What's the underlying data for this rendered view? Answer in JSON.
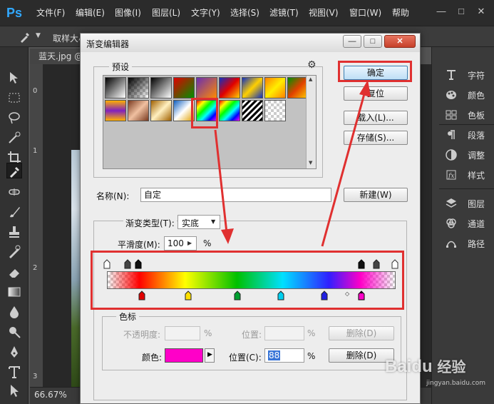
{
  "app": {
    "logo": "Ps"
  },
  "menu": [
    "文件(F)",
    "编辑(E)",
    "图像(I)",
    "图层(L)",
    "文字(Y)",
    "选择(S)",
    "滤镜(T)",
    "视图(V)",
    "窗口(W)",
    "帮助"
  ],
  "window_controls": {
    "minimize": "—",
    "restore": "□",
    "close": "✕"
  },
  "options_bar": {
    "sample_label": "取样大小"
  },
  "document": {
    "tab": "蓝天.jpg @",
    "zoom": "66.67%",
    "ruler_ticks": [
      "0",
      "1",
      "2",
      "3"
    ]
  },
  "right_panel": {
    "items": [
      {
        "label": "字符",
        "icon": "character-icon"
      },
      {
        "label": "颜色",
        "icon": "palette-icon"
      },
      {
        "label": "色板",
        "icon": "swatches-icon"
      },
      {
        "label": "段落",
        "icon": "paragraph-icon"
      },
      {
        "label": "调整",
        "icon": "adjustment-icon"
      },
      {
        "label": "样式",
        "icon": "styles-icon"
      },
      {
        "label": "图层",
        "icon": "layers-icon"
      },
      {
        "label": "通道",
        "icon": "channels-icon"
      },
      {
        "label": "路径",
        "icon": "paths-icon"
      }
    ]
  },
  "dialog": {
    "title": "渐变编辑器",
    "title_buttons": {
      "minimize": "—",
      "restore": "□",
      "close": "✕"
    },
    "presets_label": "预设",
    "gear_icon": "⚙",
    "buttons": {
      "ok": "确定",
      "reset": "复位",
      "load": "载入(L)...",
      "save": "存储(S)...",
      "new": "新建(W)"
    },
    "name_label": "名称(N):",
    "name_value": "自定",
    "gradient_type_label": "渐变类型(T):",
    "gradient_type_value": "实底",
    "smoothness_label": "平滑度(M):",
    "smoothness_value": "100",
    "smoothness_unit": "%",
    "stops_group_label": "色标",
    "opacity_label": "不透明度:",
    "opacity_unit": "%",
    "location_label_disabled": "位置:",
    "location_unit_disabled": "%",
    "delete_disabled": "删除(D)",
    "color_label": "颜色:",
    "color_value": "#ff00c8",
    "location_label": "位置(C):",
    "location_value": "88",
    "location_unit": "%",
    "delete": "删除(D)",
    "highlight_color": "#e03030"
  },
  "watermark": {
    "brand": "Baidu",
    "sub": "经验",
    "url": "jingyan.baidu.com"
  }
}
